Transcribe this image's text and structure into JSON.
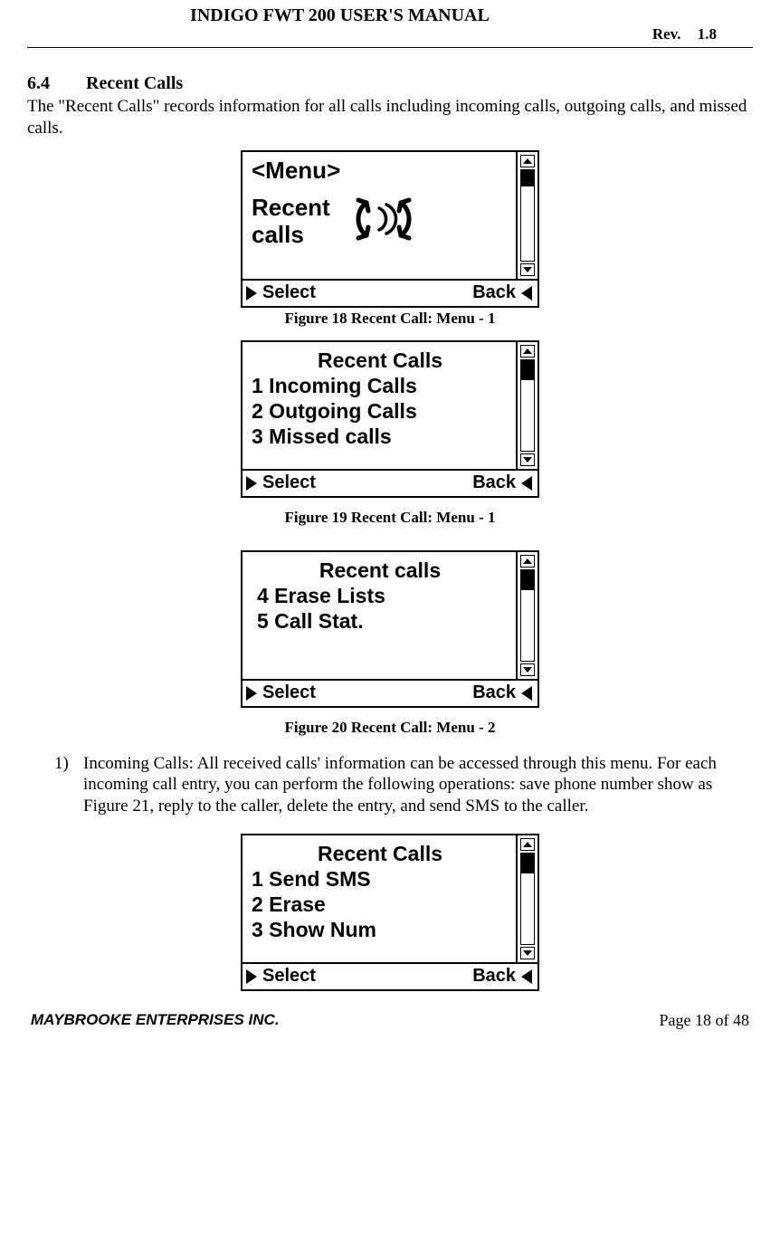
{
  "header": {
    "title": "INDIGO FWT 200 USER'S MANUAL",
    "rev_label": "Rev.",
    "rev_value": "1.8"
  },
  "section": {
    "number": "6.4",
    "title": "Recent Calls",
    "intro": "The \"Recent Calls\" records information for all calls including incoming calls, outgoing calls, and missed calls."
  },
  "figures": {
    "f18": {
      "menu_label": "<Menu>",
      "item_label": "Recent calls",
      "left_softkey": "Select",
      "right_softkey": "Back",
      "caption": "Figure 18  Recent Call: Menu - 1"
    },
    "f19": {
      "title": "Recent Calls",
      "items": [
        "1 Incoming Calls",
        "2 Outgoing Calls",
        "3 Missed calls"
      ],
      "left_softkey": "Select",
      "right_softkey": "Back",
      "caption": "Figure 19  Recent Call: Menu - 1"
    },
    "f20": {
      "title": "Recent calls",
      "items": [
        "4 Erase Lists",
        "5 Call Stat."
      ],
      "left_softkey": "Select",
      "right_softkey": "Back",
      "caption": "Figure 20  Recent Call: Menu - 2"
    },
    "f21": {
      "title": "Recent Calls",
      "items": [
        "1 Send SMS",
        "2 Erase",
        "3 Show Num"
      ],
      "left_softkey": "Select",
      "right_softkey": "Back"
    }
  },
  "list": {
    "num": "1)",
    "text": "Incoming Calls: All received calls' information can be accessed through this menu. For each incoming call entry, you can perform the following operations: save phone number show as Figure 21, reply to the caller, delete the entry, and send SMS to the caller."
  },
  "footer": {
    "company": "MAYBROOKE ENTERPRISES INC.",
    "page": "Page 18 of 48"
  }
}
